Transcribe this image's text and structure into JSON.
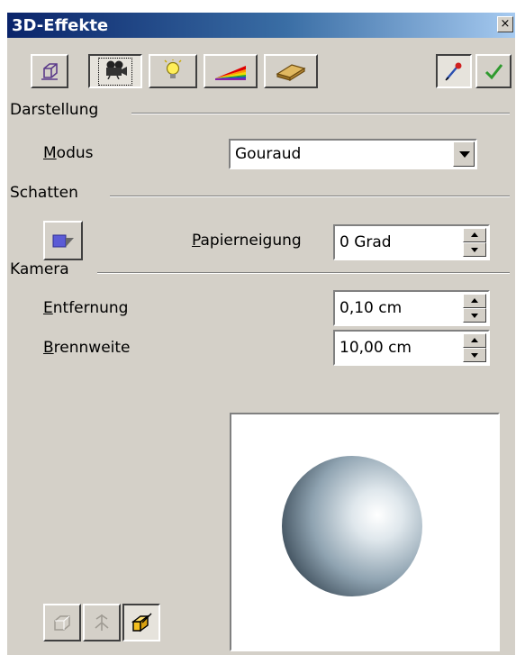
{
  "window": {
    "title": "3D-Effekte",
    "close_glyph": "×"
  },
  "toolbar": {
    "buttons": [
      {
        "name": "geometry",
        "icon": "cube-outline-icon",
        "pressed": false
      },
      {
        "name": "representation",
        "icon": "camera-icon",
        "pressed": true
      },
      {
        "name": "illumination",
        "icon": "light-bulb-icon",
        "pressed": false
      },
      {
        "name": "textures",
        "icon": "rainbow-wedge-icon",
        "pressed": false
      },
      {
        "name": "material",
        "icon": "material-bar-icon",
        "pressed": false
      }
    ],
    "right_buttons": [
      {
        "name": "pipette",
        "icon": "pipette-icon",
        "pressed": true
      },
      {
        "name": "assign",
        "icon": "checkmark-icon",
        "pressed": false
      }
    ]
  },
  "sections": {
    "darstellung": {
      "title": "Darstellung",
      "modus_label_accel": "M",
      "modus_label_rest": "odus",
      "modus_value": "Gouraud"
    },
    "schatten": {
      "title": "Schatten",
      "paper_label_accel": "P",
      "paper_label_rest": "apierneigung",
      "paper_value": "0 Grad"
    },
    "kamera": {
      "title": "Kamera",
      "entfernung_accel": "E",
      "entfernung_rest": "ntfernung",
      "entfernung_value": "0,10 cm",
      "brennweite_accel": "B",
      "brennweite_rest": "rennweite",
      "brennweite_value": "10,00 cm"
    }
  },
  "bottom_buttons": [
    {
      "name": "convert-to-3d",
      "icon": "convert-3d-icon",
      "enabled": false
    },
    {
      "name": "rotation-object",
      "icon": "rotation-object-icon",
      "enabled": false
    },
    {
      "name": "perspective",
      "icon": "perspective-icon",
      "enabled": true,
      "pressed": true
    }
  ],
  "colors": {
    "title_gradient_start": "#0a246a",
    "dialog_bg": "#d4d0c8",
    "preview_sphere": "#b9c6cf"
  }
}
